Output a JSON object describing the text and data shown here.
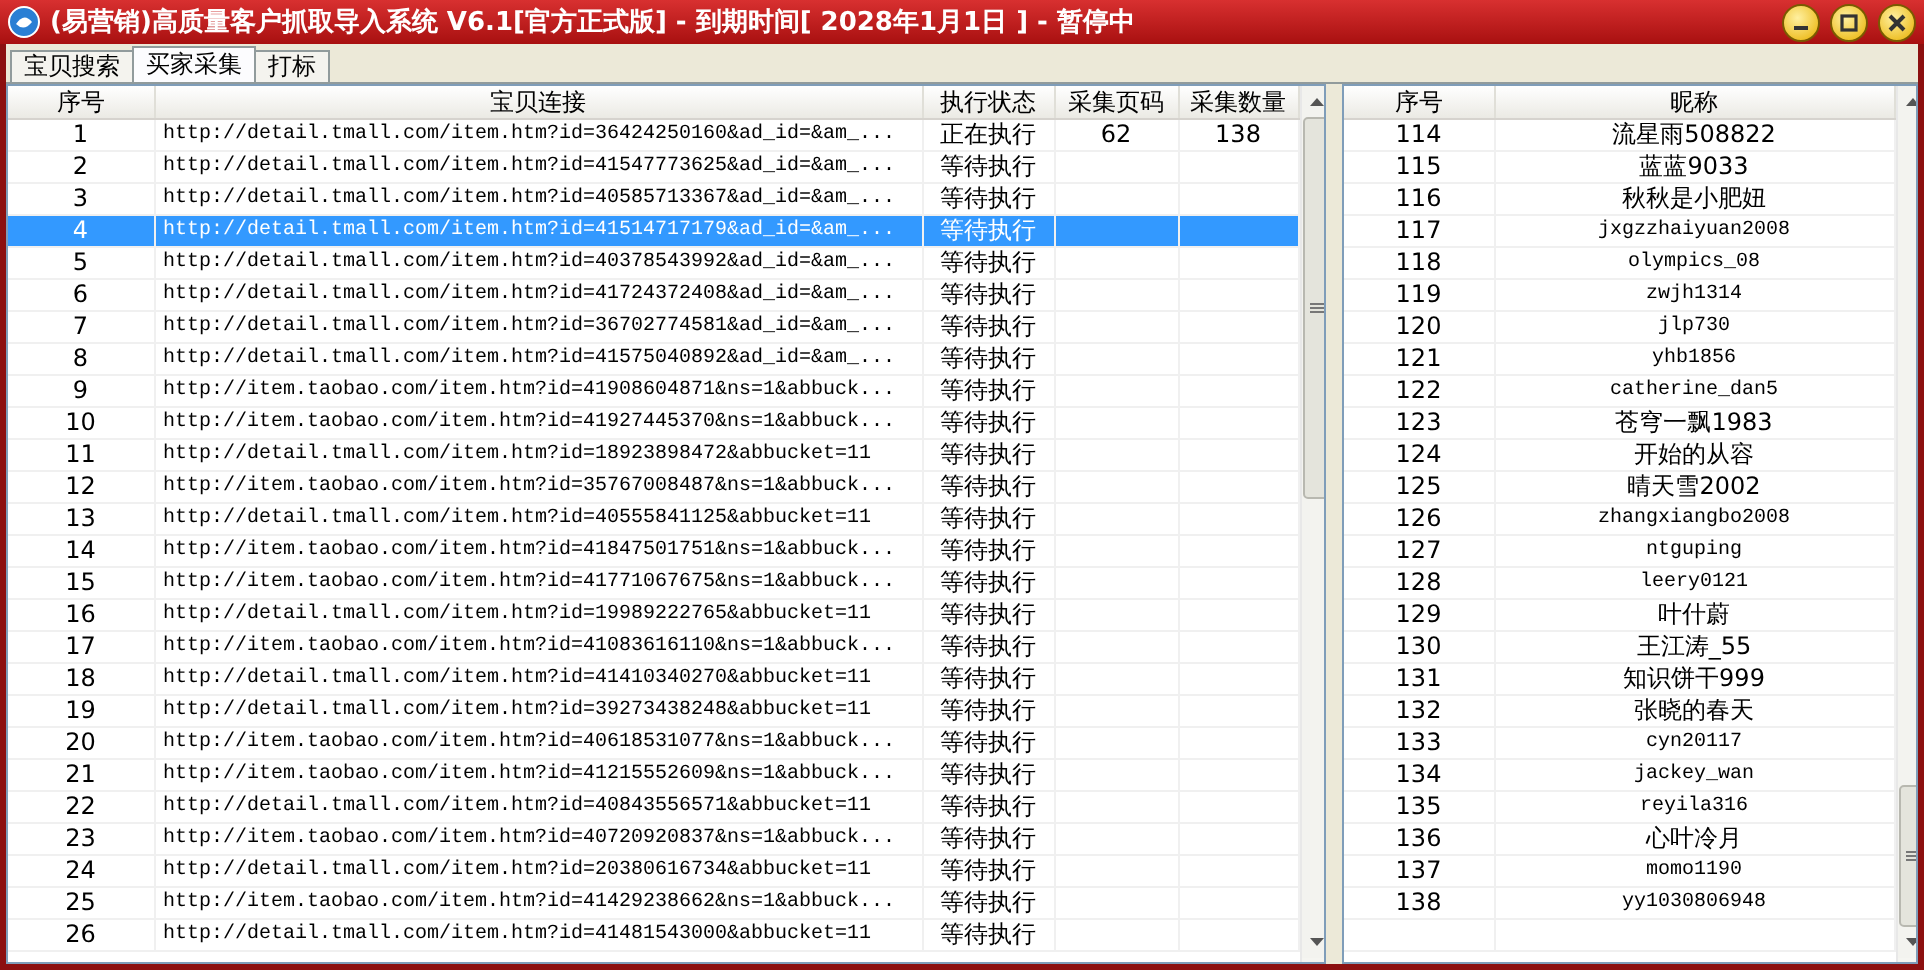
{
  "window": {
    "title": "(易营销)高质量客户抓取导入系统 V6.1[官方正式版] - 到期时间[ 2028年1月1日 ] - 暂停中"
  },
  "tabs": [
    {
      "label": "宝贝搜索",
      "selected": false
    },
    {
      "label": "买家采集",
      "selected": true
    },
    {
      "label": "打标",
      "selected": false
    }
  ],
  "left_table": {
    "columns": [
      "序号",
      "宝贝连接",
      "执行状态",
      "采集页码",
      "采集数量"
    ],
    "rows": [
      {
        "cells": [
          "1",
          "http://detail.tmall.com/item.htm?id=36424250160&ad_id=&am_...",
          "正在执行",
          "62",
          "138"
        ],
        "selected": false
      },
      {
        "cells": [
          "2",
          "http://detail.tmall.com/item.htm?id=41547773625&ad_id=&am_...",
          "等待执行",
          "",
          ""
        ],
        "selected": false
      },
      {
        "cells": [
          "3",
          "http://detail.tmall.com/item.htm?id=40585713367&ad_id=&am_...",
          "等待执行",
          "",
          ""
        ],
        "selected": false
      },
      {
        "cells": [
          "4",
          "http://detail.tmall.com/item.htm?id=41514717179&ad_id=&am_...",
          "等待执行",
          "",
          ""
        ],
        "selected": true
      },
      {
        "cells": [
          "5",
          "http://detail.tmall.com/item.htm?id=40378543992&ad_id=&am_...",
          "等待执行",
          "",
          ""
        ],
        "selected": false
      },
      {
        "cells": [
          "6",
          "http://detail.tmall.com/item.htm?id=41724372408&ad_id=&am_...",
          "等待执行",
          "",
          ""
        ],
        "selected": false
      },
      {
        "cells": [
          "7",
          "http://detail.tmall.com/item.htm?id=36702774581&ad_id=&am_...",
          "等待执行",
          "",
          ""
        ],
        "selected": false
      },
      {
        "cells": [
          "8",
          "http://detail.tmall.com/item.htm?id=41575040892&ad_id=&am_...",
          "等待执行",
          "",
          ""
        ],
        "selected": false
      },
      {
        "cells": [
          "9",
          "http://item.taobao.com/item.htm?id=41908604871&ns=1&abbuck...",
          "等待执行",
          "",
          ""
        ],
        "selected": false
      },
      {
        "cells": [
          "10",
          "http://item.taobao.com/item.htm?id=41927445370&ns=1&abbuck...",
          "等待执行",
          "",
          ""
        ],
        "selected": false
      },
      {
        "cells": [
          "11",
          "http://detail.tmall.com/item.htm?id=18923898472&abbucket=11",
          "等待执行",
          "",
          ""
        ],
        "selected": false
      },
      {
        "cells": [
          "12",
          "http://item.taobao.com/item.htm?id=35767008487&ns=1&abbuck...",
          "等待执行",
          "",
          ""
        ],
        "selected": false
      },
      {
        "cells": [
          "13",
          "http://detail.tmall.com/item.htm?id=40555841125&abbucket=11",
          "等待执行",
          "",
          ""
        ],
        "selected": false
      },
      {
        "cells": [
          "14",
          "http://item.taobao.com/item.htm?id=41847501751&ns=1&abbuck...",
          "等待执行",
          "",
          ""
        ],
        "selected": false
      },
      {
        "cells": [
          "15",
          "http://item.taobao.com/item.htm?id=41771067675&ns=1&abbuck...",
          "等待执行",
          "",
          ""
        ],
        "selected": false
      },
      {
        "cells": [
          "16",
          "http://detail.tmall.com/item.htm?id=19989222765&abbucket=11",
          "等待执行",
          "",
          ""
        ],
        "selected": false
      },
      {
        "cells": [
          "17",
          "http://item.taobao.com/item.htm?id=41083616110&ns=1&abbuck...",
          "等待执行",
          "",
          ""
        ],
        "selected": false
      },
      {
        "cells": [
          "18",
          "http://detail.tmall.com/item.htm?id=41410340270&abbucket=11",
          "等待执行",
          "",
          ""
        ],
        "selected": false
      },
      {
        "cells": [
          "19",
          "http://detail.tmall.com/item.htm?id=39273438248&abbucket=11",
          "等待执行",
          "",
          ""
        ],
        "selected": false
      },
      {
        "cells": [
          "20",
          "http://item.taobao.com/item.htm?id=40618531077&ns=1&abbuck...",
          "等待执行",
          "",
          ""
        ],
        "selected": false
      },
      {
        "cells": [
          "21",
          "http://item.taobao.com/item.htm?id=41215552609&ns=1&abbuck...",
          "等待执行",
          "",
          ""
        ],
        "selected": false
      },
      {
        "cells": [
          "22",
          "http://detail.tmall.com/item.htm?id=40843556571&abbucket=11",
          "等待执行",
          "",
          ""
        ],
        "selected": false
      },
      {
        "cells": [
          "23",
          "http://item.taobao.com/item.htm?id=40720920837&ns=1&abbuck...",
          "等待执行",
          "",
          ""
        ],
        "selected": false
      },
      {
        "cells": [
          "24",
          "http://detail.tmall.com/item.htm?id=20380616734&abbucket=11",
          "等待执行",
          "",
          ""
        ],
        "selected": false
      },
      {
        "cells": [
          "25",
          "http://item.taobao.com/item.htm?id=41429238662&ns=1&abbuck...",
          "等待执行",
          "",
          ""
        ],
        "selected": false
      },
      {
        "cells": [
          "26",
          "http://detail.tmall.com/item.htm?id=41481543000&abbucket=11",
          "等待执行",
          "",
          ""
        ],
        "selected": false
      }
    ]
  },
  "right_table": {
    "columns": [
      "序号",
      "昵称"
    ],
    "rows": [
      [
        "114",
        "流星雨508822"
      ],
      [
        "115",
        "蓝蓝9033"
      ],
      [
        "116",
        "秋秋是小肥妞"
      ],
      [
        "117",
        "jxgzzhaiyuan2008"
      ],
      [
        "118",
        "olympics_08"
      ],
      [
        "119",
        "zwjh1314"
      ],
      [
        "120",
        "jlp730"
      ],
      [
        "121",
        "yhb1856"
      ],
      [
        "122",
        "catherine_dan5"
      ],
      [
        "123",
        "苍穹一飘1983"
      ],
      [
        "124",
        "开始的从容"
      ],
      [
        "125",
        "晴天雪2002"
      ],
      [
        "126",
        "zhangxiangbo2008"
      ],
      [
        "127",
        "ntguping"
      ],
      [
        "128",
        "leery0121"
      ],
      [
        "129",
        "叶什蔚"
      ],
      [
        "130",
        "王江涛_55"
      ],
      [
        "131",
        "知识饼干999"
      ],
      [
        "132",
        "张晓的春天"
      ],
      [
        "133",
        "cyn20117"
      ],
      [
        "134",
        "jackey_wan"
      ],
      [
        "135",
        "reyila316"
      ],
      [
        "136",
        "心叶冷月"
      ],
      [
        "137",
        "momo1190"
      ],
      [
        "138",
        "yy1030806948"
      ]
    ]
  }
}
